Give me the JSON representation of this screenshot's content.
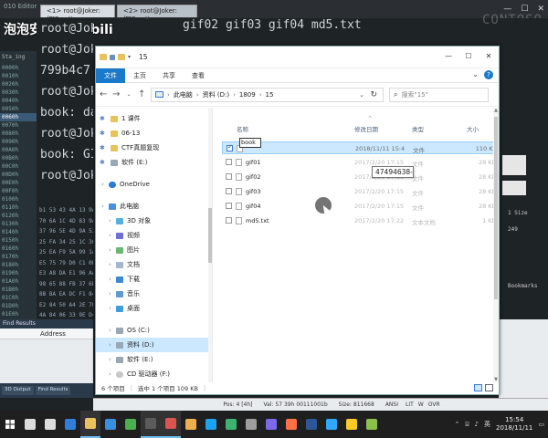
{
  "background": {
    "editor_title": "010 Editor",
    "watermark": "泡泡安全 | bilibili",
    "watermark_right": "CONTOSO",
    "terminal_tabs": [
      {
        "label": "<1> root@Joker: /mn..."
      },
      {
        "label": "<2> root@Joker: /mn..."
      }
    ],
    "terminal_top_text": "gif02  gif03  gif04  md5.txt",
    "terminal_lines": [
      "root@Jok",
      "root@Jok",
      "799b4c7",
      "root@Jok",
      "book: da",
      "root@Jok",
      "book: GI",
      "root@Jok"
    ],
    "left_panel_header": "Sta_ing",
    "left_addresses": [
      "0000h",
      "0010h",
      "0020h",
      "0030h",
      "0040h",
      "0050h",
      "0060h",
      "0070h",
      "0080h",
      "0090h",
      "00A0h",
      "00B0h",
      "00C0h",
      "00D0h",
      "00E0h",
      "00F0h",
      "0100h",
      "0110h",
      "0120h",
      "0130h",
      "0140h",
      "0150h",
      "0160h",
      "0170h",
      "0180h",
      "0190h",
      "01A0h",
      "01B0h",
      "01C0h",
      "01D0h",
      "01E0h",
      "01F0h",
      "0200h"
    ],
    "hex_rows": [
      "b1 53 43 4A 13 9A",
      "70 6A 1C 4D 83 9A",
      "37 96 5E 4D 9A 53",
      "25 FA 34 25 1C 36",
      "25 EA F9 5A 99 1A",
      "E5 75 79 D0 C1 0E",
      "E3 A8 DA E1 96 AA",
      "98 65 88 FB 37 6D",
      "8B BA EA DC F1 84",
      "E2 84 50 A4 2E 7F",
      "4A 84 06 33 9E D4"
    ],
    "find_results_title": "Find Results",
    "find_results_column": "Address",
    "bottom_tabs": [
      "3D Output",
      "Find Results"
    ],
    "right_term_labels": [
      "1 Size",
      "249",
      "Bookmarks"
    ],
    "editor_status_left": [
      "Pos: 4 [4h]",
      "Val: 57 39h 00111001b",
      "Size: 811668",
      "ANSI"
    ],
    "editor_status_right": [
      "LIT",
      "W",
      "OVR"
    ]
  },
  "explorer": {
    "title": "15",
    "ribbon_tabs": [
      "文件",
      "主页",
      "共享",
      "查看"
    ],
    "breadcrumb": [
      "此电脑",
      "资料 (D:)",
      "1809",
      "15"
    ],
    "search_placeholder": "搜索\"15\"",
    "nav_items": [
      {
        "label": "1 课件",
        "icon": "pinned-folder-icon"
      },
      {
        "label": "06-13",
        "icon": "pinned-folder-icon"
      },
      {
        "label": "CTF真题复现",
        "icon": "pinned-folder-icon"
      },
      {
        "label": "软件 (E:)",
        "icon": "pinned-drive-icon"
      },
      {
        "label": "OneDrive",
        "icon": "onedrive-icon"
      },
      {
        "label": "此电脑",
        "icon": "this-pc-icon"
      },
      {
        "label": "3D 对象",
        "icon": "3d-objects-icon"
      },
      {
        "label": "视频",
        "icon": "video-icon"
      },
      {
        "label": "图片",
        "icon": "pictures-icon"
      },
      {
        "label": "文档",
        "icon": "documents-icon"
      },
      {
        "label": "下载",
        "icon": "downloads-icon"
      },
      {
        "label": "音乐",
        "icon": "music-icon"
      },
      {
        "label": "桌面",
        "icon": "desktop-icon"
      },
      {
        "label": "OS (C:)",
        "icon": "drive-c-icon"
      },
      {
        "label": "资料 (D:)",
        "icon": "drive-d-icon",
        "selected": true
      },
      {
        "label": "软件 (E:)",
        "icon": "drive-e-icon"
      },
      {
        "label": "CD 驱动器 (F:)",
        "icon": "cd-drive-icon"
      }
    ],
    "columns": {
      "name": "名称",
      "date": "修改日期",
      "type": "类型",
      "size": "大小"
    },
    "files": [
      {
        "name": "book",
        "date": "2018/11/11 15:4",
        "type": "文件",
        "size": "110 KB",
        "selected": true
      },
      {
        "name": "gif01",
        "date": "2017/2/20 17:15",
        "type": "文件",
        "size": "28 KB"
      },
      {
        "name": "gif02",
        "date": "2017/2/20 17:15",
        "type": "文件",
        "size": "28 KB"
      },
      {
        "name": "gif03",
        "date": "2017/2/20 17:15",
        "type": "文件",
        "size": "28 KB"
      },
      {
        "name": "gif04",
        "date": "2017/2/20 17:15",
        "type": "文件",
        "size": "28 KB"
      },
      {
        "name": "md5.txt",
        "date": "2017/2/20 17:22",
        "type": "文本文档",
        "size": "1 KB"
      }
    ],
    "rename_value": "book",
    "tooltip": "47494638-",
    "status": {
      "count": "6 个项目",
      "selected": "选中 1 个项目  109 KB"
    }
  },
  "taskbar": {
    "apps": [
      {
        "name": "search",
        "color": "#dcdcdc"
      },
      {
        "name": "task-view",
        "color": "#dcdcdc"
      },
      {
        "name": "edge",
        "color": "#2f7ed8"
      },
      {
        "name": "explorer",
        "color": "#e8c25a",
        "active": true
      },
      {
        "name": "store",
        "color": "#3a8fe0"
      },
      {
        "name": "chrome",
        "color": "#4caf50"
      },
      {
        "name": "terminal",
        "color": "#5b5b5b",
        "active": true
      },
      {
        "name": "editor",
        "color": "#d9534f",
        "active": true
      },
      {
        "name": "media",
        "color": "#f0ad4e"
      },
      {
        "name": "qq",
        "color": "#1da1f2"
      },
      {
        "name": "wechat",
        "color": "#3cb371"
      },
      {
        "name": "settings",
        "color": "#9e9e9e"
      },
      {
        "name": "vm",
        "color": "#7b68ee"
      },
      {
        "name": "tool",
        "color": "#ff7043"
      },
      {
        "name": "word",
        "color": "#2b579a"
      },
      {
        "name": "ps",
        "color": "#31a8ff"
      },
      {
        "name": "notes",
        "color": "#ffca28"
      },
      {
        "name": "app18",
        "color": "#8bc34a"
      }
    ],
    "tray_lang": "英",
    "time": "15:54",
    "date": "2018/11/11"
  }
}
